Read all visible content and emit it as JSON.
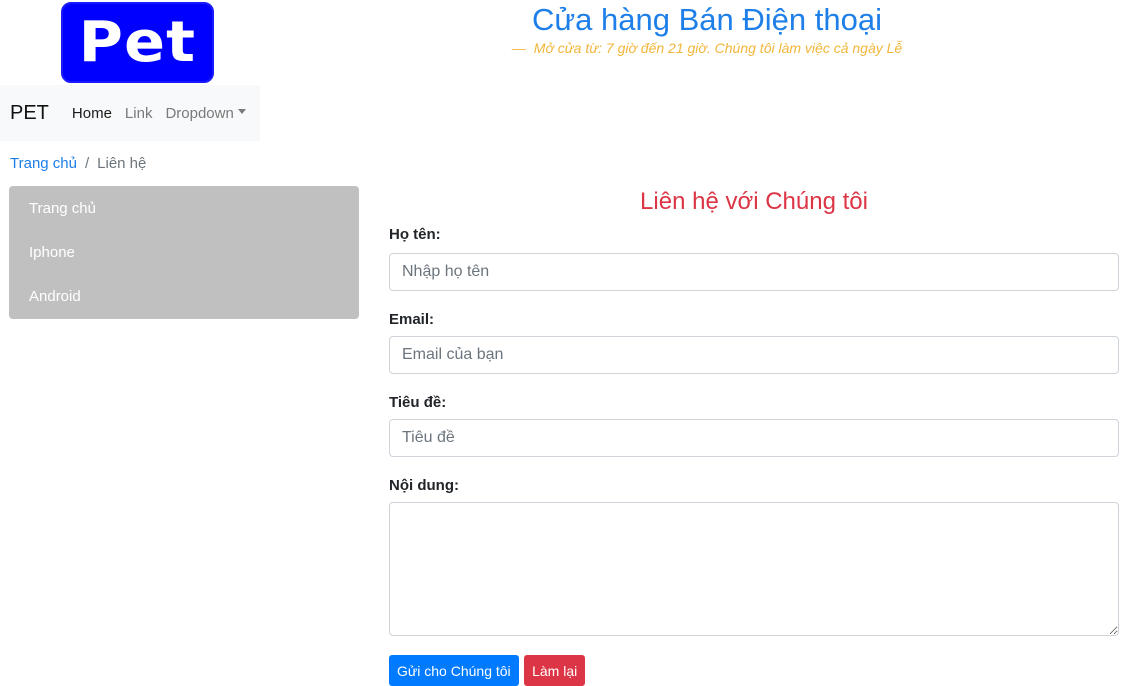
{
  "header": {
    "logo_text": "Pet",
    "title": "Cửa hàng Bán Điện thoại",
    "slogan_dash": "—",
    "slogan": "Mở cửa từ: 7 giờ đến 21 giờ. Chúng tôi làm việc cả ngày Lễ"
  },
  "navbar": {
    "brand": "PET",
    "links": [
      {
        "label": "Home",
        "active": true
      },
      {
        "label": "Link",
        "active": false
      },
      {
        "label": "Dropdown",
        "active": false
      }
    ]
  },
  "breadcrumb": {
    "home": "Trang chủ",
    "separator": "/",
    "current": "Liên hệ"
  },
  "sidebar": {
    "items": [
      "Trang chủ",
      "Iphone",
      "Android"
    ]
  },
  "form": {
    "title": "Liên hệ với Chúng tôi",
    "name_label": "Họ tên:",
    "name_placeholder": "Nhập họ tên",
    "email_label": "Email:",
    "email_placeholder": "Email của bạn",
    "subject_label": "Tiêu đề:",
    "subject_placeholder": "Tiêu đề",
    "content_label": "Nội dung:",
    "submit_label": "Gửi cho Chúng tôi",
    "reset_label": "Làm lại"
  },
  "colors": {
    "accent": "#1e7fe8",
    "logo_bg": "#0000ff",
    "slogan": "#f2b63a",
    "form_title": "#dc3545",
    "sidebar_bg": "#c0c0c0"
  }
}
